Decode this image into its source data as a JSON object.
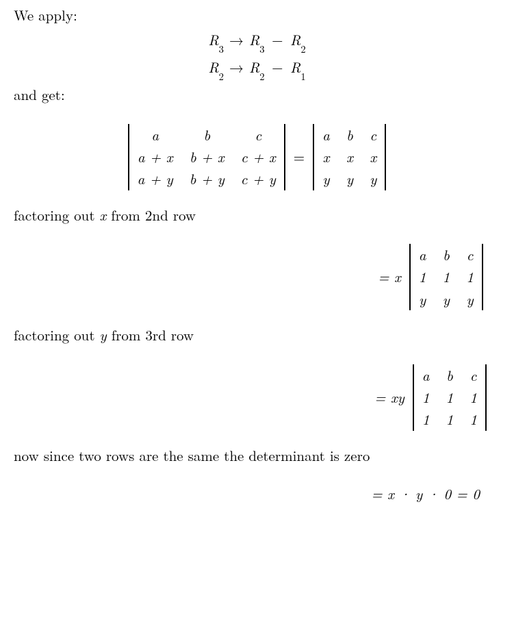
{
  "intro": "We apply:",
  "op1": {
    "lhs": "R",
    "li": "3",
    "rhs1": "R",
    "ri1": "3",
    "rhs2": "R",
    "ri2": "2"
  },
  "op2": {
    "lhs": "R",
    "li": "2",
    "rhs1": "R",
    "ri1": "2",
    "rhs2": "R",
    "ri2": "1"
  },
  "andget": "and get:",
  "m1": {
    "r1": [
      "a",
      "b",
      "c"
    ],
    "r2": [
      "a + x",
      "b + x",
      "c + x"
    ],
    "r3": [
      "a + y",
      "b + y",
      "c + y"
    ]
  },
  "m2": {
    "r1": [
      "a",
      "b",
      "c"
    ],
    "r2": [
      "x",
      "x",
      "x"
    ],
    "r3": [
      "y",
      "y",
      "y"
    ]
  },
  "fx": "factoring out x from 2nd row",
  "coef1": "= x",
  "m3": {
    "r1": [
      "a",
      "b",
      "c"
    ],
    "r2": [
      "1",
      "1",
      "1"
    ],
    "r3": [
      "y",
      "y",
      "y"
    ]
  },
  "fy": "factoring out y from 3rd row",
  "coef2": "= xy",
  "m4": {
    "r1": [
      "a",
      "b",
      "c"
    ],
    "r2": [
      "1",
      "1",
      "1"
    ],
    "r3": [
      "1",
      "1",
      "1"
    ]
  },
  "zero": "now since two rows are the same the determinant is zero",
  "final": "= x · y · 0 = 0"
}
